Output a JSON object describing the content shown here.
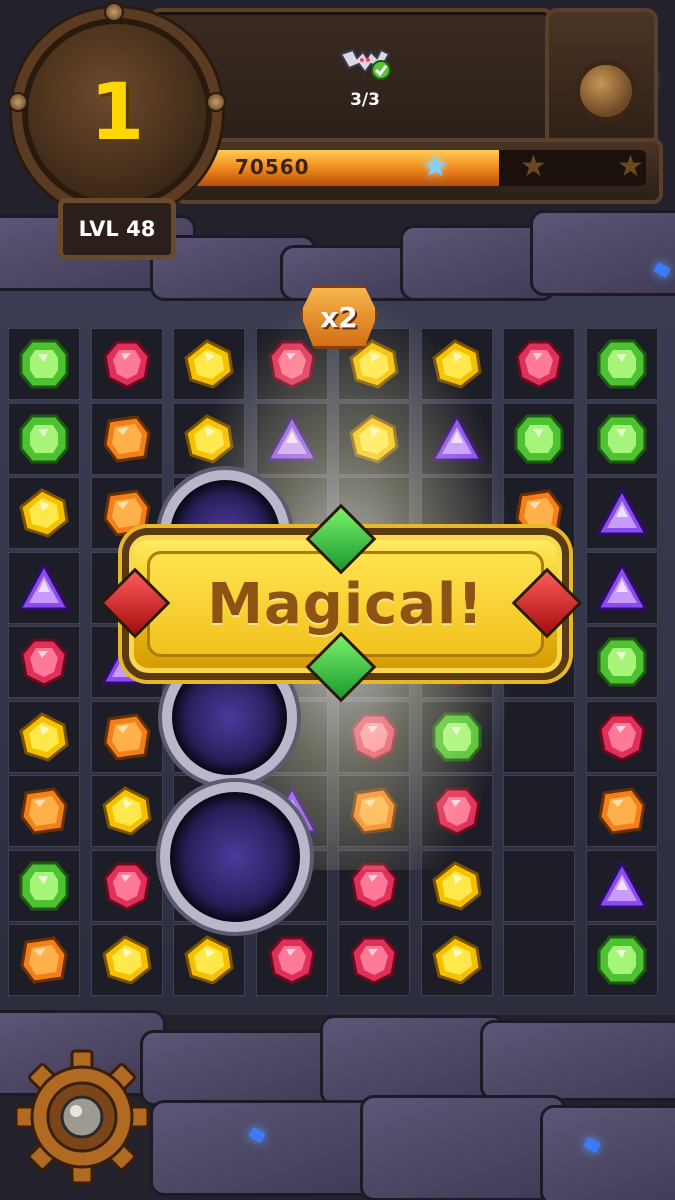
{
  "hud": {
    "moves_left": "1",
    "level_label": "LVL 48",
    "score": "70560",
    "score_progress_percent": 68,
    "stars_earned": 1,
    "stars_total": 3,
    "objective": {
      "icon": "bat-icon",
      "count": "3/3",
      "completed": true
    }
  },
  "combo": {
    "label": "x2"
  },
  "banner": {
    "text": "Magical!"
  },
  "colors": {
    "score_bar": "#f08a1d",
    "banner": "#f0c515",
    "star_earned": "#7fd0ff",
    "star_empty": "#6a4a1d"
  },
  "board": {
    "columns": 8,
    "rows": 9,
    "legend": {
      "G": "green-gem",
      "R": "red-gem",
      "Y": "yellow-gem",
      "O": "orange-gem",
      "P": "purple-gem"
    },
    "grid": [
      [
        "G",
        "R",
        "Y",
        "R",
        "",
        "Y",
        "Y",
        "R",
        "G"
      ],
      [
        "G",
        "O",
        "Y",
        "P",
        "",
        "Y",
        "P",
        "G",
        "G"
      ],
      [
        "Y",
        "O",
        "",
        "",
        "",
        "",
        "",
        "O",
        "P"
      ],
      [
        "P",
        "",
        "",
        "",
        "",
        "",
        "",
        "",
        "P"
      ],
      [
        "R",
        "P",
        "",
        "",
        "",
        "",
        "R",
        "",
        "G"
      ],
      [
        "Y",
        "O",
        "",
        "",
        "G",
        "R",
        "G",
        "",
        "R"
      ],
      [
        "O",
        "Y",
        "",
        "P",
        "Y",
        "O",
        "R",
        "",
        "O"
      ],
      [
        "G",
        "R",
        "",
        "",
        "O",
        "R",
        "Y",
        "",
        "P"
      ],
      [
        "O",
        "Y",
        "Y",
        "R",
        "G",
        "R",
        "Y",
        "",
        "G"
      ]
    ]
  },
  "settings": {
    "icon": "gear-icon"
  }
}
